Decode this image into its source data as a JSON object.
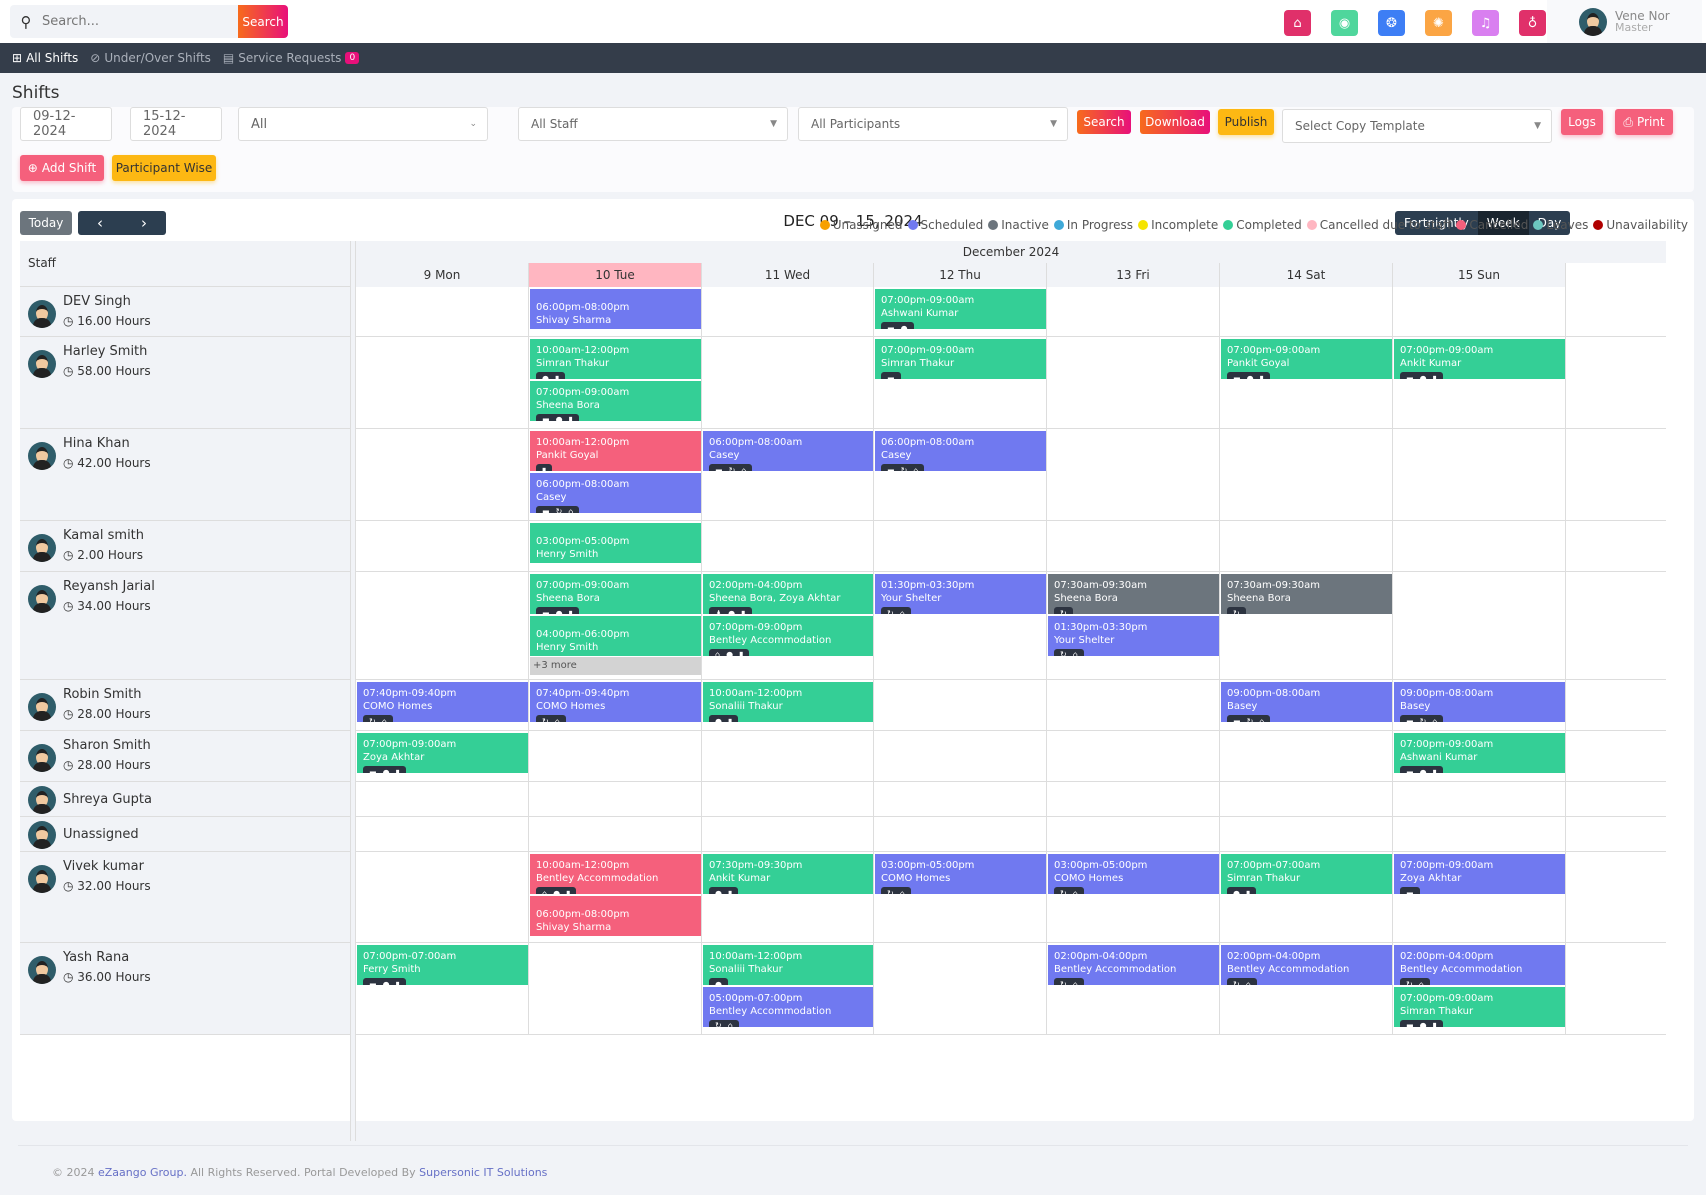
{
  "topbar": {
    "search_placeholder": "Search...",
    "search_button": "Search",
    "icons": [
      {
        "name": "home-icon",
        "glyph": "⌂",
        "color": "#e0306a"
      },
      {
        "name": "location-icon",
        "glyph": "◉",
        "color": "#4fd69c"
      },
      {
        "name": "support-icon",
        "glyph": "❂",
        "color": "#3d7ef5"
      },
      {
        "name": "settings-icon",
        "glyph": "✺",
        "color": "#fba544"
      },
      {
        "name": "bell-icon",
        "glyph": "♫",
        "color": "#d97ff0"
      },
      {
        "name": "bulb-icon",
        "glyph": "♁",
        "color": "#e0306a"
      }
    ],
    "user": {
      "name": "Vene Nor",
      "role": "Master"
    }
  },
  "nav": {
    "items": [
      {
        "label": "All Shifts",
        "icon": "⊞",
        "active": true
      },
      {
        "label": "Under/Over Shifts",
        "icon": "⊘",
        "active": false
      },
      {
        "label": "Service Requests",
        "icon": "▤",
        "active": false,
        "badge": "0"
      }
    ]
  },
  "page": {
    "title": "Shifts"
  },
  "filters": {
    "start_date": "09-12-2024",
    "end_date": "15-12-2024",
    "type_select": "All",
    "staff_select": "All Staff",
    "participants_select": "All Participants",
    "search_label": "Search",
    "download_label": "Download",
    "publish_label": "Publish",
    "copy_template_placeholder": "Select Copy Template",
    "logs_label": "Logs",
    "print_label": "Print",
    "add_shift_label": "Add Shift",
    "participant_wise_label": "Participant Wise"
  },
  "calendar": {
    "today_label": "Today",
    "prev_icon": "‹",
    "next_icon": "›",
    "title": "DEC 09 – 15, 2024",
    "views": [
      {
        "label": "Fortnightly",
        "active": false
      },
      {
        "label": "Week",
        "active": true
      },
      {
        "label": "Day",
        "active": false
      }
    ],
    "legend": [
      {
        "label": "Unassigned",
        "color": "#f7a000"
      },
      {
        "label": "Scheduled",
        "color": "#7079f0"
      },
      {
        "label": "Inactive",
        "color": "#6c757d"
      },
      {
        "label": "In Progress",
        "color": "#3fa9d8"
      },
      {
        "label": "Incomplete",
        "color": "#f5e400"
      },
      {
        "label": "Completed",
        "color": "#34cf96"
      },
      {
        "label": "Cancelled due to staff",
        "color": "#ffb6c1"
      },
      {
        "label": "Cancelled",
        "color": "#f5607c"
      },
      {
        "label": "Leaves",
        "color": "#6cc7c0"
      },
      {
        "label": "Unavailability",
        "color": "#b00000"
      }
    ],
    "staff_header": "Staff",
    "month_label": "December 2024",
    "days": [
      {
        "label": "9 Mon",
        "today": false
      },
      {
        "label": "10 Tue",
        "today": true
      },
      {
        "label": "11 Wed",
        "today": false
      },
      {
        "label": "12 Thu",
        "today": false
      },
      {
        "label": "13 Fri",
        "today": false
      },
      {
        "label": "14 Sat",
        "today": false
      },
      {
        "label": "15 Sun",
        "today": false
      }
    ],
    "staff": [
      {
        "name": "DEV Singh",
        "hours": "16.00 Hours",
        "shifts": [
          {
            "day": 1,
            "slot": 0,
            "time": "06:00pm-08:00pm",
            "who": "Shivay Sharma",
            "status": "scheduled",
            "icons": []
          },
          {
            "day": 3,
            "slot": 0,
            "time": "07:00pm-09:00am",
            "who": "Ashwani Kumar",
            "status": "completed",
            "icons": [
              "bed",
              "check"
            ]
          }
        ]
      },
      {
        "name": "Harley Smith",
        "hours": "58.00 Hours",
        "shifts": [
          {
            "day": 1,
            "slot": 0,
            "time": "10:00am-12:00pm",
            "who": "Simran Thakur",
            "status": "completed",
            "icons": [
              "check",
              "lock"
            ]
          },
          {
            "day": 1,
            "slot": 1,
            "time": "07:00pm-09:00am",
            "who": "Sheena Bora",
            "status": "completed",
            "icons": [
              "bed",
              "check",
              "lock"
            ]
          },
          {
            "day": 3,
            "slot": 0,
            "time": "07:00pm-09:00am",
            "who": "Simran Thakur",
            "status": "completed",
            "icons": [
              "bed"
            ]
          },
          {
            "day": 5,
            "slot": 0,
            "time": "07:00pm-09:00am",
            "who": "Pankit Goyal",
            "status": "completed",
            "icons": [
              "bed",
              "check",
              "lock"
            ]
          },
          {
            "day": 6,
            "slot": 0,
            "time": "07:00pm-09:00am",
            "who": "Ankit Kumar",
            "status": "completed",
            "icons": [
              "bed",
              "check",
              "lock"
            ]
          }
        ]
      },
      {
        "name": "Hina Khan",
        "hours": "42.00 Hours",
        "shifts": [
          {
            "day": 1,
            "slot": 0,
            "time": "10:00am-12:00pm",
            "who": "Pankit Goyal",
            "status": "cancelled",
            "icons": [
              "lock"
            ]
          },
          {
            "day": 1,
            "slot": 1,
            "time": "06:00pm-08:00am",
            "who": "Casey",
            "status": "scheduled",
            "icons": [
              "bed",
              "repeat",
              "home"
            ]
          },
          {
            "day": 2,
            "slot": 0,
            "time": "06:00pm-08:00am",
            "who": "Casey",
            "status": "scheduled",
            "icons": [
              "bed",
              "repeat",
              "home"
            ]
          },
          {
            "day": 3,
            "slot": 0,
            "time": "06:00pm-08:00am",
            "who": "Casey",
            "status": "scheduled",
            "icons": [
              "bed",
              "repeat",
              "home"
            ]
          }
        ]
      },
      {
        "name": "Kamal smith",
        "hours": "2.00 Hours",
        "shifts": [
          {
            "day": 1,
            "slot": 0,
            "time": "03:00pm-05:00pm",
            "who": "Henry Smith",
            "status": "completed",
            "icons": []
          }
        ]
      },
      {
        "name": "Reyansh Jarial",
        "hours": "34.00 Hours",
        "more": {
          "day": 1,
          "label": "+3 more"
        },
        "shifts": [
          {
            "day": 1,
            "slot": 0,
            "time": "07:00pm-09:00am",
            "who": "Sheena Bora",
            "status": "completed",
            "icons": [
              "bed",
              "check",
              "lock"
            ]
          },
          {
            "day": 1,
            "slot": 1,
            "time": "04:00pm-06:00pm",
            "who": "Henry Smith",
            "status": "completed",
            "icons": []
          },
          {
            "day": 2,
            "slot": 0,
            "time": "02:00pm-04:00pm",
            "who": "Sheena Bora, Zoya Akhtar",
            "status": "completed",
            "icons": [
              "group",
              "check",
              "lock"
            ]
          },
          {
            "day": 2,
            "slot": 1,
            "time": "07:00pm-09:00pm",
            "who": "Bentley Accommodation",
            "status": "completed",
            "icons": [
              "home",
              "check",
              "lock"
            ]
          },
          {
            "day": 3,
            "slot": 0,
            "time": "01:30pm-03:30pm",
            "who": "Your Shelter",
            "status": "scheduled",
            "icons": [
              "repeat",
              "home"
            ]
          },
          {
            "day": 4,
            "slot": 0,
            "time": "07:30am-09:30am",
            "who": "Sheena Bora",
            "status": "inactive",
            "icons": [
              "repeat"
            ]
          },
          {
            "day": 4,
            "slot": 1,
            "time": "01:30pm-03:30pm",
            "who": "Your Shelter",
            "status": "scheduled",
            "icons": [
              "repeat",
              "home"
            ]
          },
          {
            "day": 5,
            "slot": 0,
            "time": "07:30am-09:30am",
            "who": "Sheena Bora",
            "status": "inactive",
            "icons": [
              "repeat"
            ]
          }
        ]
      },
      {
        "name": "Robin Smith",
        "hours": "28.00 Hours",
        "shifts": [
          {
            "day": 0,
            "slot": 0,
            "time": "07:40pm-09:40pm",
            "who": "COMO Homes",
            "status": "scheduled",
            "icons": [
              "repeat",
              "home"
            ]
          },
          {
            "day": 1,
            "slot": 0,
            "time": "07:40pm-09:40pm",
            "who": "COMO Homes",
            "status": "scheduled",
            "icons": [
              "repeat",
              "home"
            ]
          },
          {
            "day": 2,
            "slot": 0,
            "time": "10:00am-12:00pm",
            "who": "Sonaliii Thakur",
            "status": "completed",
            "icons": [
              "check",
              "lock"
            ]
          },
          {
            "day": 5,
            "slot": 0,
            "time": "09:00pm-08:00am",
            "who": "Basey",
            "status": "scheduled",
            "icons": [
              "bed",
              "repeat",
              "home"
            ]
          },
          {
            "day": 6,
            "slot": 0,
            "time": "09:00pm-08:00am",
            "who": "Basey",
            "status": "scheduled",
            "icons": [
              "bed",
              "repeat",
              "home"
            ]
          }
        ]
      },
      {
        "name": "Sharon Smith",
        "hours": "28.00 Hours",
        "shifts": [
          {
            "day": 0,
            "slot": 0,
            "time": "07:00pm-09:00am",
            "who": "Zoya Akhtar",
            "status": "completed",
            "icons": [
              "bed",
              "check",
              "lock"
            ]
          },
          {
            "day": 6,
            "slot": 0,
            "time": "07:00pm-09:00am",
            "who": "Ashwani Kumar",
            "status": "completed",
            "icons": [
              "bed",
              "check",
              "lock"
            ]
          }
        ]
      },
      {
        "name": "Shreya Gupta",
        "hours": "",
        "shifts": []
      },
      {
        "name": "Unassigned",
        "hours": "",
        "shifts": []
      },
      {
        "name": "Vivek kumar",
        "hours": "32.00 Hours",
        "shifts": [
          {
            "day": 1,
            "slot": 0,
            "time": "10:00am-12:00pm",
            "who": "Bentley Accommodation",
            "status": "cancelled",
            "icons": [
              "home",
              "check",
              "lock"
            ]
          },
          {
            "day": 1,
            "slot": 1,
            "time": "06:00pm-08:00pm",
            "who": "Shivay Sharma",
            "status": "cancelled",
            "icons": []
          },
          {
            "day": 2,
            "slot": 0,
            "time": "07:30pm-09:30pm",
            "who": "Ankit Kumar",
            "status": "completed",
            "icons": [
              "check",
              "lock"
            ]
          },
          {
            "day": 3,
            "slot": 0,
            "time": "03:00pm-05:00pm",
            "who": "COMO Homes",
            "status": "scheduled",
            "icons": [
              "repeat",
              "home"
            ]
          },
          {
            "day": 4,
            "slot": 0,
            "time": "03:00pm-05:00pm",
            "who": "COMO Homes",
            "status": "scheduled",
            "icons": [
              "repeat",
              "home"
            ]
          },
          {
            "day": 5,
            "slot": 0,
            "time": "07:00pm-07:00am",
            "who": "Simran Thakur",
            "status": "completed",
            "icons": [
              "check",
              "lock"
            ]
          },
          {
            "day": 6,
            "slot": 0,
            "time": "07:00pm-09:00am",
            "who": "Zoya Akhtar",
            "status": "scheduled",
            "icons": [
              "bed"
            ]
          }
        ]
      },
      {
        "name": "Yash Rana",
        "hours": "36.00 Hours",
        "shifts": [
          {
            "day": 0,
            "slot": 0,
            "time": "07:00pm-07:00am",
            "who": "Ferry Smith",
            "status": "completed",
            "icons": [
              "bed",
              "check",
              "lock"
            ]
          },
          {
            "day": 2,
            "slot": 0,
            "time": "10:00am-12:00pm",
            "who": "Sonaliii Thakur",
            "status": "completed",
            "icons": [
              "check"
            ]
          },
          {
            "day": 2,
            "slot": 1,
            "time": "05:00pm-07:00pm",
            "who": "Bentley Accommodation",
            "status": "scheduled",
            "icons": [
              "repeat",
              "home"
            ]
          },
          {
            "day": 4,
            "slot": 0,
            "time": "02:00pm-04:00pm",
            "who": "Bentley Accommodation",
            "status": "scheduled",
            "icons": [
              "repeat",
              "home"
            ]
          },
          {
            "day": 5,
            "slot": 0,
            "time": "02:00pm-04:00pm",
            "who": "Bentley Accommodation",
            "status": "scheduled",
            "icons": [
              "repeat",
              "home"
            ]
          },
          {
            "day": 6,
            "slot": 0,
            "time": "02:00pm-04:00pm",
            "who": "Bentley Accommodation",
            "status": "scheduled",
            "icons": [
              "repeat",
              "home"
            ]
          },
          {
            "day": 6,
            "slot": 1,
            "time": "07:00pm-09:00am",
            "who": "Simran Thakur",
            "status": "completed",
            "icons": [
              "bed",
              "check",
              "lock"
            ]
          }
        ]
      }
    ],
    "status_colors": {
      "scheduled": "#7079f0",
      "completed": "#34cf96",
      "cancelled": "#f5607c",
      "inactive": "#6c757d"
    },
    "icon_glyphs": {
      "bed": "▬",
      "check": "●",
      "lock": "▮",
      "repeat": "↻",
      "home": "⌂",
      "group": "♟"
    }
  },
  "footer": {
    "prefix": "© 2024 ",
    "company": "eZaango Group.",
    "middle": " All Rights Reserved. Portal Developed By ",
    "developer": "Supersonic IT Solutions"
  }
}
